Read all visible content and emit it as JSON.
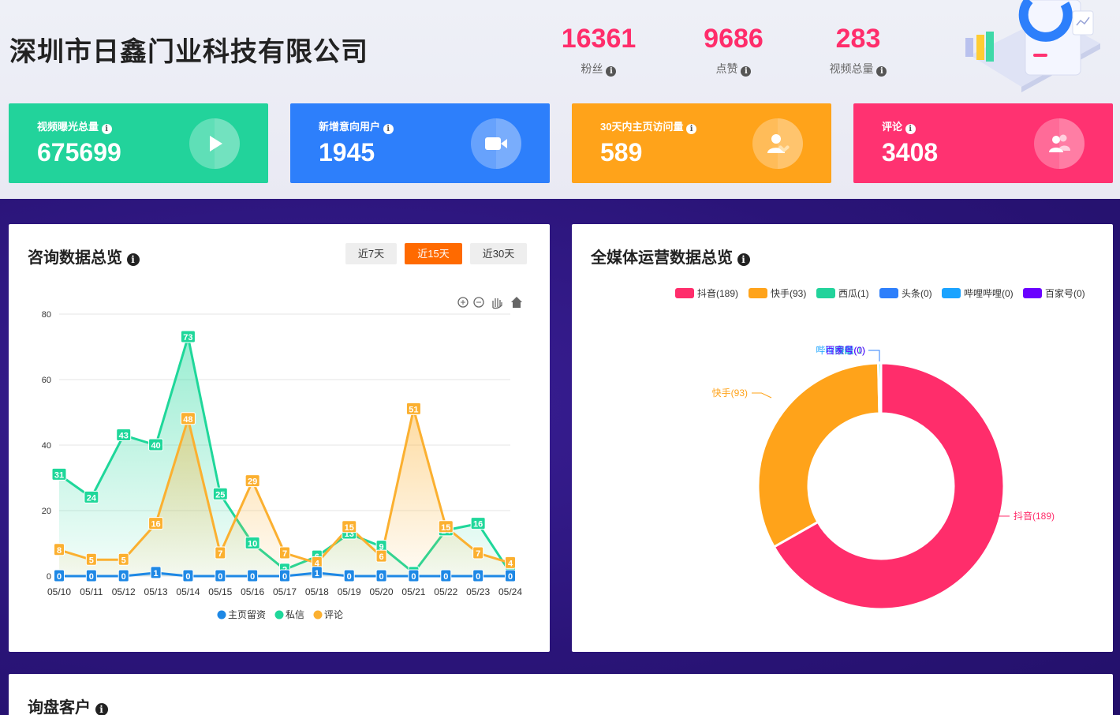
{
  "company": "深圳市日鑫门业科技有限公司",
  "stats": [
    {
      "value": "16361",
      "label": "粉丝"
    },
    {
      "value": "9686",
      "label": "点赞"
    },
    {
      "value": "283",
      "label": "视频总量"
    }
  ],
  "cards": [
    {
      "title": "视频曝光总量",
      "value": "675699",
      "color": "#22d39b",
      "icon": "play-icon"
    },
    {
      "title": "新增意向用户",
      "value": "1945",
      "color": "#2d7ffb",
      "icon": "video-camera-icon"
    },
    {
      "title": "30天内主页访问量",
      "value": "589",
      "color": "#ffa31a",
      "icon": "user-heart-icon"
    },
    {
      "title": "评论",
      "value": "3408",
      "color": "#ff3271",
      "icon": "users-icon"
    }
  ],
  "consult": {
    "title": "咨询数据总览",
    "ranges": [
      "近7天",
      "近15天",
      "近30天"
    ],
    "active_range": "近15天"
  },
  "media": {
    "title": "全媒体运营数据总览"
  },
  "inquiry": {
    "title": "询盘客户"
  },
  "colors": {
    "home": "#1e88e5",
    "dm": "#1fd79a",
    "comment": "#fbb030",
    "douyin": "#ff2d6b",
    "kuaishou": "#ffa31a",
    "xigua": "#22d39b",
    "toutiao": "#2d7ffb",
    "bilibili": "#1aa3ff",
    "baijia": "#6a00ff"
  },
  "chart_data": [
    {
      "type": "line",
      "x": [
        "05/10",
        "05/11",
        "05/12",
        "05/13",
        "05/14",
        "05/15",
        "05/16",
        "05/17",
        "05/18",
        "05/19",
        "05/20",
        "05/21",
        "05/22",
        "05/23",
        "05/24"
      ],
      "ylim": [
        0,
        80
      ],
      "yticks": [
        0,
        20,
        40,
        60,
        80
      ],
      "grid": true,
      "legend_position": "bottom",
      "series": [
        {
          "name": "主页留资",
          "values": [
            0,
            0,
            0,
            1,
            0,
            0,
            0,
            0,
            1,
            0,
            0,
            0,
            0,
            0,
            0
          ]
        },
        {
          "name": "私信",
          "values": [
            31,
            24,
            43,
            40,
            73,
            25,
            10,
            2,
            6,
            13,
            9,
            1,
            14,
            16,
            1
          ]
        },
        {
          "name": "评论",
          "values": [
            8,
            5,
            5,
            16,
            48,
            7,
            29,
            7,
            4,
            15,
            6,
            51,
            15,
            7,
            4
          ]
        }
      ]
    },
    {
      "type": "pie",
      "donut": true,
      "legend_position": "top",
      "slices": [
        {
          "name": "抖音",
          "value": 189,
          "label": "抖音(189)"
        },
        {
          "name": "快手",
          "value": 93,
          "label": "快手(93)"
        },
        {
          "name": "西瓜",
          "value": 1,
          "label": "西瓜(1)"
        },
        {
          "name": "头条",
          "value": 0,
          "label": "头条(0)"
        },
        {
          "name": "哔哩哔哩",
          "value": 0,
          "label": "哔哩哔哩(0)"
        },
        {
          "name": "百家号",
          "value": 0,
          "label": "百家号(0)"
        }
      ]
    }
  ]
}
